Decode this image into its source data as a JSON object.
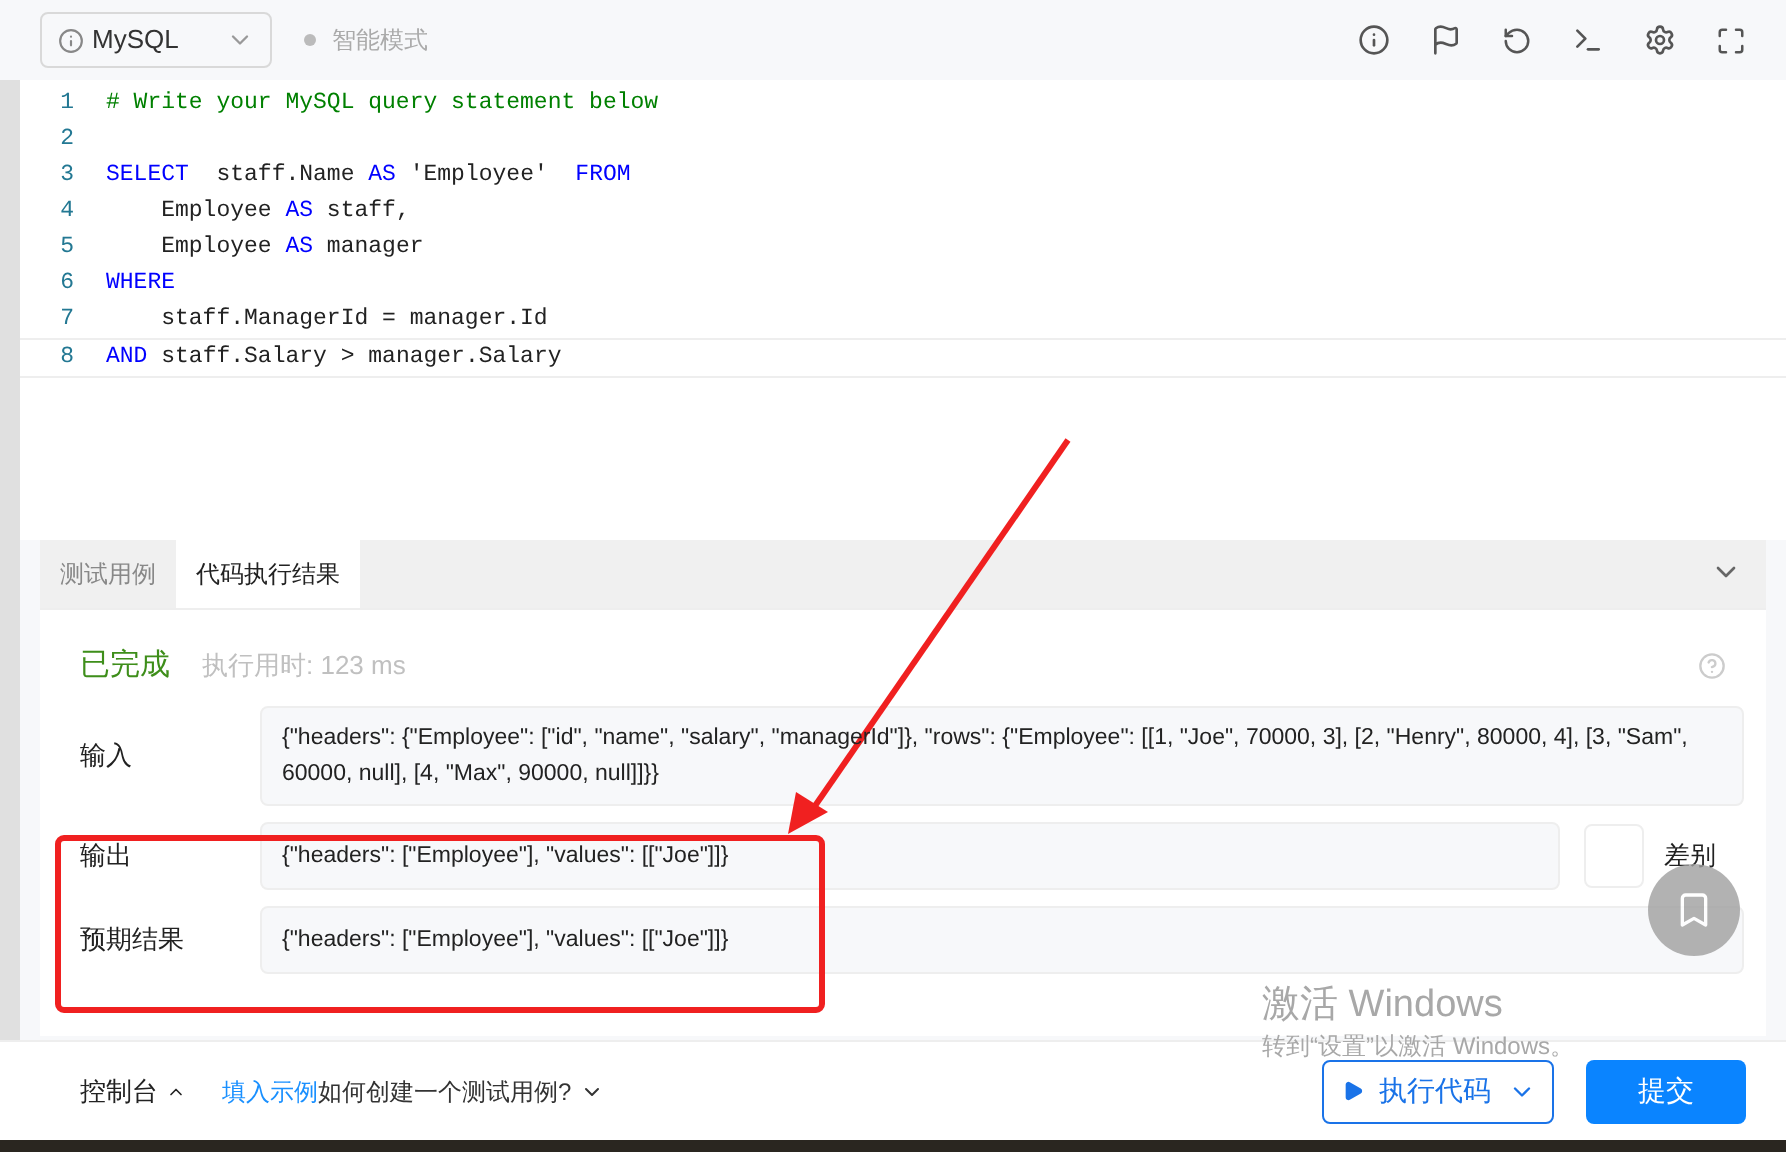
{
  "toolbar": {
    "language": "MySQL",
    "mode": "智能模式"
  },
  "editor": {
    "lines": [
      {
        "number": "1",
        "tokens": [
          {
            "kind": "comment",
            "text": "# Write your MySQL query statement below"
          }
        ]
      },
      {
        "number": "2"
      },
      {
        "number": "3",
        "tokens": [
          {
            "kind": "keyword",
            "text": "SELECT"
          },
          {
            "kind": "plain",
            "text": "  staff.Name "
          },
          {
            "kind": "keyword",
            "text": "AS"
          },
          {
            "kind": "plain",
            "text": " 'Employee'  "
          },
          {
            "kind": "keyword",
            "text": "FROM"
          }
        ]
      },
      {
        "number": "4",
        "tokens": [
          {
            "kind": "plain",
            "text": "    Employee "
          },
          {
            "kind": "keyword",
            "text": "AS"
          },
          {
            "kind": "plain",
            "text": " staff,"
          }
        ]
      },
      {
        "number": "5",
        "tokens": [
          {
            "kind": "plain",
            "text": "    Employee "
          },
          {
            "kind": "keyword",
            "text": "AS"
          },
          {
            "kind": "plain",
            "text": " manager"
          }
        ]
      },
      {
        "number": "6",
        "tokens": [
          {
            "kind": "keyword",
            "text": "WHERE"
          }
        ]
      },
      {
        "number": "7",
        "tokens": [
          {
            "kind": "plain",
            "text": "    staff.ManagerId = manager.Id"
          }
        ]
      },
      {
        "number": "8",
        "tokens": [
          {
            "kind": "keyword",
            "text": "AND"
          },
          {
            "kind": "plain",
            "text": " staff.Salary > manager.Salary"
          }
        ]
      }
    ]
  },
  "result_tabs": [
    {
      "label": "测试用例",
      "selected": false
    },
    {
      "label": "代码执行结果",
      "selected": true
    }
  ],
  "result": {
    "status": "已完成",
    "runtime": "执行用时: 123 ms",
    "rows": [
      {
        "label": "输入",
        "value": "{\"headers\": {\"Employee\": [\"id\", \"name\", \"salary\", \"managerId\"]}, \"rows\": {\"Employee\": [[1, \"Joe\", 70000, 3], [2, \"Henry\", 80000, 4], [3, \"Sam\", 60000, null], [4, \"Max\", 90000, null]]}}"
      },
      {
        "label": "输出",
        "value": "{\"headers\": [\"Employee\"], \"values\": [[\"Joe\"]]}"
      },
      {
        "label": "预期结果",
        "value": "{\"headers\": [\"Employee\"], \"values\": [[\"Joe\"]]}"
      }
    ],
    "diff": {
      "label": "差别",
      "on": false
    }
  },
  "footer": {
    "console": "控制台",
    "example_link": "填入示例",
    "help": "如何创建一个测试用例?",
    "run": "执行代码",
    "submit": "提交"
  },
  "watermark": {
    "title": "激活 Windows",
    "subtitle": "转到“设置”以激活 Windows。"
  }
}
